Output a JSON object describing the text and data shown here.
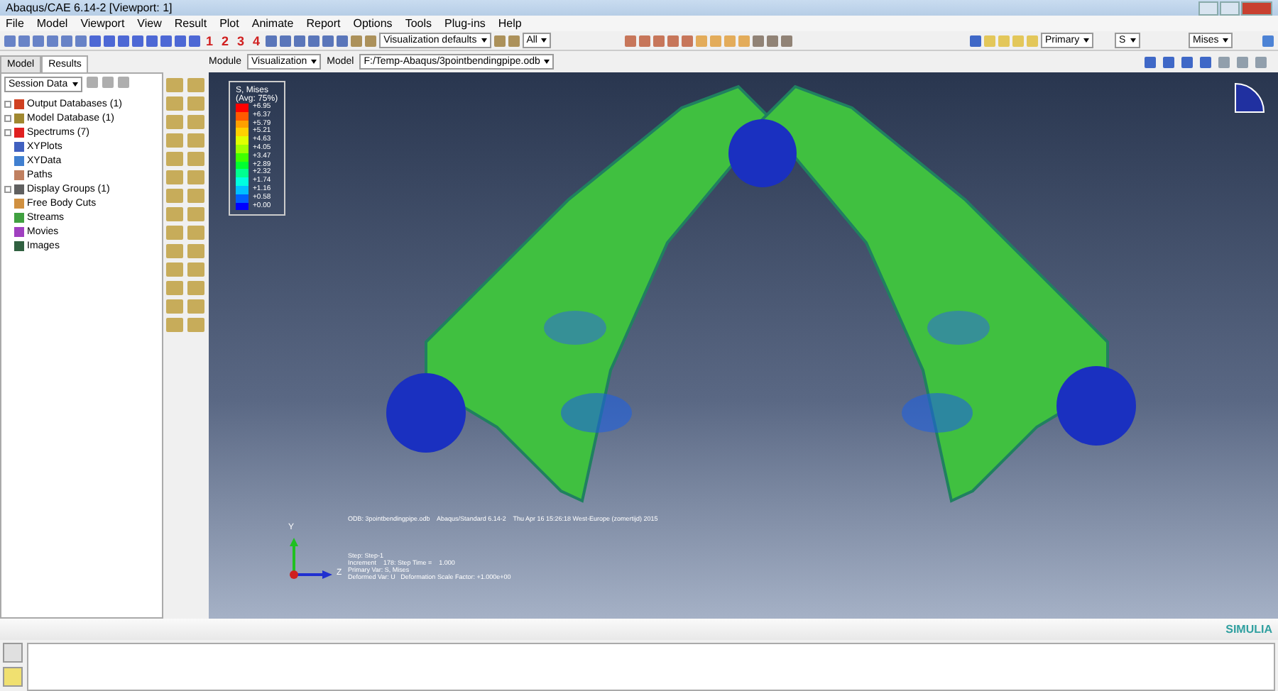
{
  "window": {
    "title": "Abaqus/CAE 6.14-2 [Viewport: 1]"
  },
  "menu": [
    "File",
    "Model",
    "Viewport",
    "View",
    "Result",
    "Plot",
    "Animate",
    "Report",
    "Options",
    "Tools",
    "Plug-ins",
    "Help"
  ],
  "toolbar": {
    "numbers": [
      "1",
      "2",
      "3",
      "4"
    ],
    "style_dropdown": "Visualization defaults",
    "selection_dropdown": "All",
    "field_dropdowns": [
      "Primary",
      "S",
      "Mises"
    ]
  },
  "tabs": [
    {
      "label": "Model",
      "selected": false
    },
    {
      "label": "Results",
      "selected": true
    }
  ],
  "session_dropdown": "Session Data",
  "tree": [
    {
      "label": "Output Databases (1)",
      "expandable": true,
      "color": "#d04020"
    },
    {
      "label": "Model Database (1)",
      "expandable": true,
      "color": "#a08830"
    },
    {
      "label": "Spectrums (7)",
      "expandable": true,
      "color": "#e02020"
    },
    {
      "label": "XYPlots",
      "expandable": false,
      "color": "#4060c0"
    },
    {
      "label": "XYData",
      "expandable": false,
      "color": "#4080d0"
    },
    {
      "label": "Paths",
      "expandable": false,
      "color": "#c08060"
    },
    {
      "label": "Display Groups (1)",
      "expandable": true,
      "color": "#606060"
    },
    {
      "label": "Free Body Cuts",
      "expandable": false,
      "color": "#d09040"
    },
    {
      "label": "Streams",
      "expandable": false,
      "color": "#40a040"
    },
    {
      "label": "Movies",
      "expandable": false,
      "color": "#a040c0"
    },
    {
      "label": "Images",
      "expandable": false,
      "color": "#306040"
    }
  ],
  "context": {
    "module_label": "Module",
    "module": "Visualization",
    "model_label": "Model",
    "model": "F:/Temp-Abaqus/3pointbendingpipe.odb"
  },
  "legend": {
    "title": "S, Mises",
    "subtitle": "(Avg: 75%)",
    "entries": [
      {
        "value": "+6.95",
        "color": "#ff0000"
      },
      {
        "value": "+6.37",
        "color": "#ff5a00"
      },
      {
        "value": "+5.79",
        "color": "#ffa000"
      },
      {
        "value": "+5.21",
        "color": "#ffd000"
      },
      {
        "value": "+4.63",
        "color": "#e0ff00"
      },
      {
        "value": "+4.05",
        "color": "#a0ff00"
      },
      {
        "value": "+3.47",
        "color": "#40ff00"
      },
      {
        "value": "+2.89",
        "color": "#00ff30"
      },
      {
        "value": "+2.32",
        "color": "#00ff90"
      },
      {
        "value": "+1.74",
        "color": "#00ffe0"
      },
      {
        "value": "+1.16",
        "color": "#00c0ff"
      },
      {
        "value": "+0.58",
        "color": "#0060ff"
      },
      {
        "value": "+0.00",
        "color": "#0000ff"
      }
    ]
  },
  "odb_line": "ODB: 3pointbendingpipe.odb    Abaqus/Standard 6.14-2    Thu Apr 16 15:26:18 West-Europe (zomertijd) 2015",
  "step_info": [
    "Step: Step-1",
    "Increment    178: Step Time =    1.000",
    "Primary Var: S, Mises",
    "Deformed Var: U   Deformation Scale Factor: +1.000e+00"
  ],
  "triad": {
    "y": "Y",
    "z": "Z"
  },
  "brand": "SIMULIA"
}
